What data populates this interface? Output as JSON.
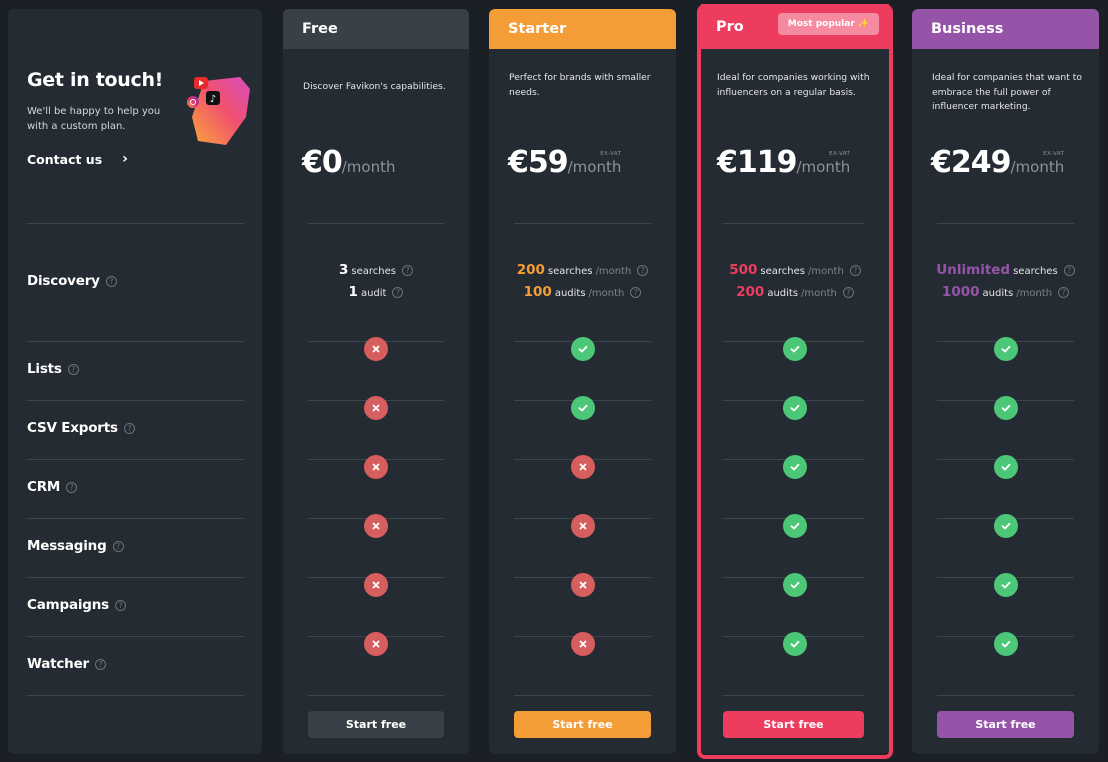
{
  "contact_card": {
    "title": "Get in touch!",
    "subtitle": "We'll be happy to help you with a custom plan.",
    "contact_label": "Contact us",
    "chevron": "›"
  },
  "features": [
    {
      "label": "Discovery"
    },
    {
      "label": "Lists"
    },
    {
      "label": "CSV Exports"
    },
    {
      "label": "CRM"
    },
    {
      "label": "Messaging"
    },
    {
      "label": "Campaigns"
    },
    {
      "label": "Watcher"
    }
  ],
  "help_icon_glyph": "?",
  "plans": [
    {
      "name": "Free",
      "accent": "#3a4048",
      "description": "Discover Favikon's capabilities.",
      "price": "€0",
      "period": "/month",
      "vat": "",
      "discovery": {
        "searches_num": "3",
        "searches_label": "searches",
        "searches_period": "",
        "audits_num": "1",
        "audits_label": "audit",
        "audits_period": ""
      },
      "number_color": "#ffffff",
      "features": [
        false,
        false,
        false,
        false,
        false,
        false
      ],
      "cta": "Start free",
      "cta_color": "#3a4048"
    },
    {
      "name": "Starter",
      "accent": "#f49d37",
      "description": "Perfect for brands with smaller needs.",
      "price": "€59",
      "period": "/month",
      "vat": "EX-VAT",
      "discovery": {
        "searches_num": "200",
        "searches_label": "searches",
        "searches_period": "/month",
        "audits_num": "100",
        "audits_label": "audits",
        "audits_period": "/month"
      },
      "number_color": "#f49d37",
      "features": [
        true,
        true,
        false,
        false,
        false,
        false
      ],
      "cta": "Start free",
      "cta_color": "#f49d37"
    },
    {
      "name": "Pro",
      "accent": "#ee3c5e",
      "badge": "Most popular",
      "badge_icon": "✨",
      "description": "Ideal for companies working with influencers on a regular basis.",
      "price": "€119",
      "period": "/month",
      "vat": "EX-VAT",
      "discovery": {
        "searches_num": "500",
        "searches_label": "searches",
        "searches_period": "/month",
        "audits_num": "200",
        "audits_label": "audits",
        "audits_period": "/month"
      },
      "number_color": "#ee3c5e",
      "features": [
        true,
        true,
        true,
        true,
        true,
        true
      ],
      "cta": "Start free",
      "cta_color": "#ee3c5e"
    },
    {
      "name": "Business",
      "accent": "#9654a8",
      "description": "Ideal for companies that want to embrace the full power of influencer marketing.",
      "price": "€249",
      "period": "/month",
      "vat": "EX-VAT",
      "discovery": {
        "searches_num": "Unlimited",
        "searches_label": "searches",
        "searches_period": "",
        "audits_num": "1000",
        "audits_label": "audits",
        "audits_period": "/month"
      },
      "number_color": "#9654a8",
      "features": [
        true,
        true,
        true,
        true,
        true,
        true
      ],
      "cta": "Start free",
      "cta_color": "#9654a8"
    }
  ]
}
